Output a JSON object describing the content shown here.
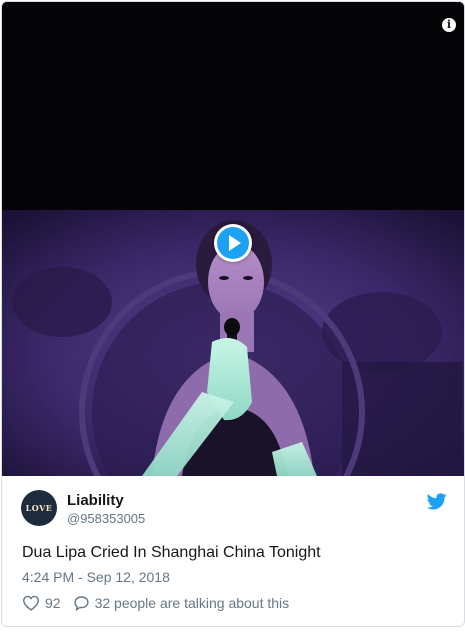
{
  "tweet": {
    "author": {
      "display_name": "Liability",
      "handle": "@958353005",
      "avatar_text": "LOVE"
    },
    "text": "Dua Lipa Cried In Shanghai China Tonight",
    "timestamp": "4:24 PM - Sep 12, 2018",
    "likes": "92",
    "talking": "32 people are talking about this"
  },
  "media": {
    "type": "video",
    "play_icon": "play-icon",
    "info_icon": "info-icon"
  },
  "colors": {
    "accent": "#1da1f2",
    "text": "#14171a",
    "muted": "#657786",
    "border": "#d8dde1"
  },
  "icons": {
    "brand": "twitter-bird-icon",
    "like": "heart-icon",
    "reply": "speech-bubble-icon"
  }
}
